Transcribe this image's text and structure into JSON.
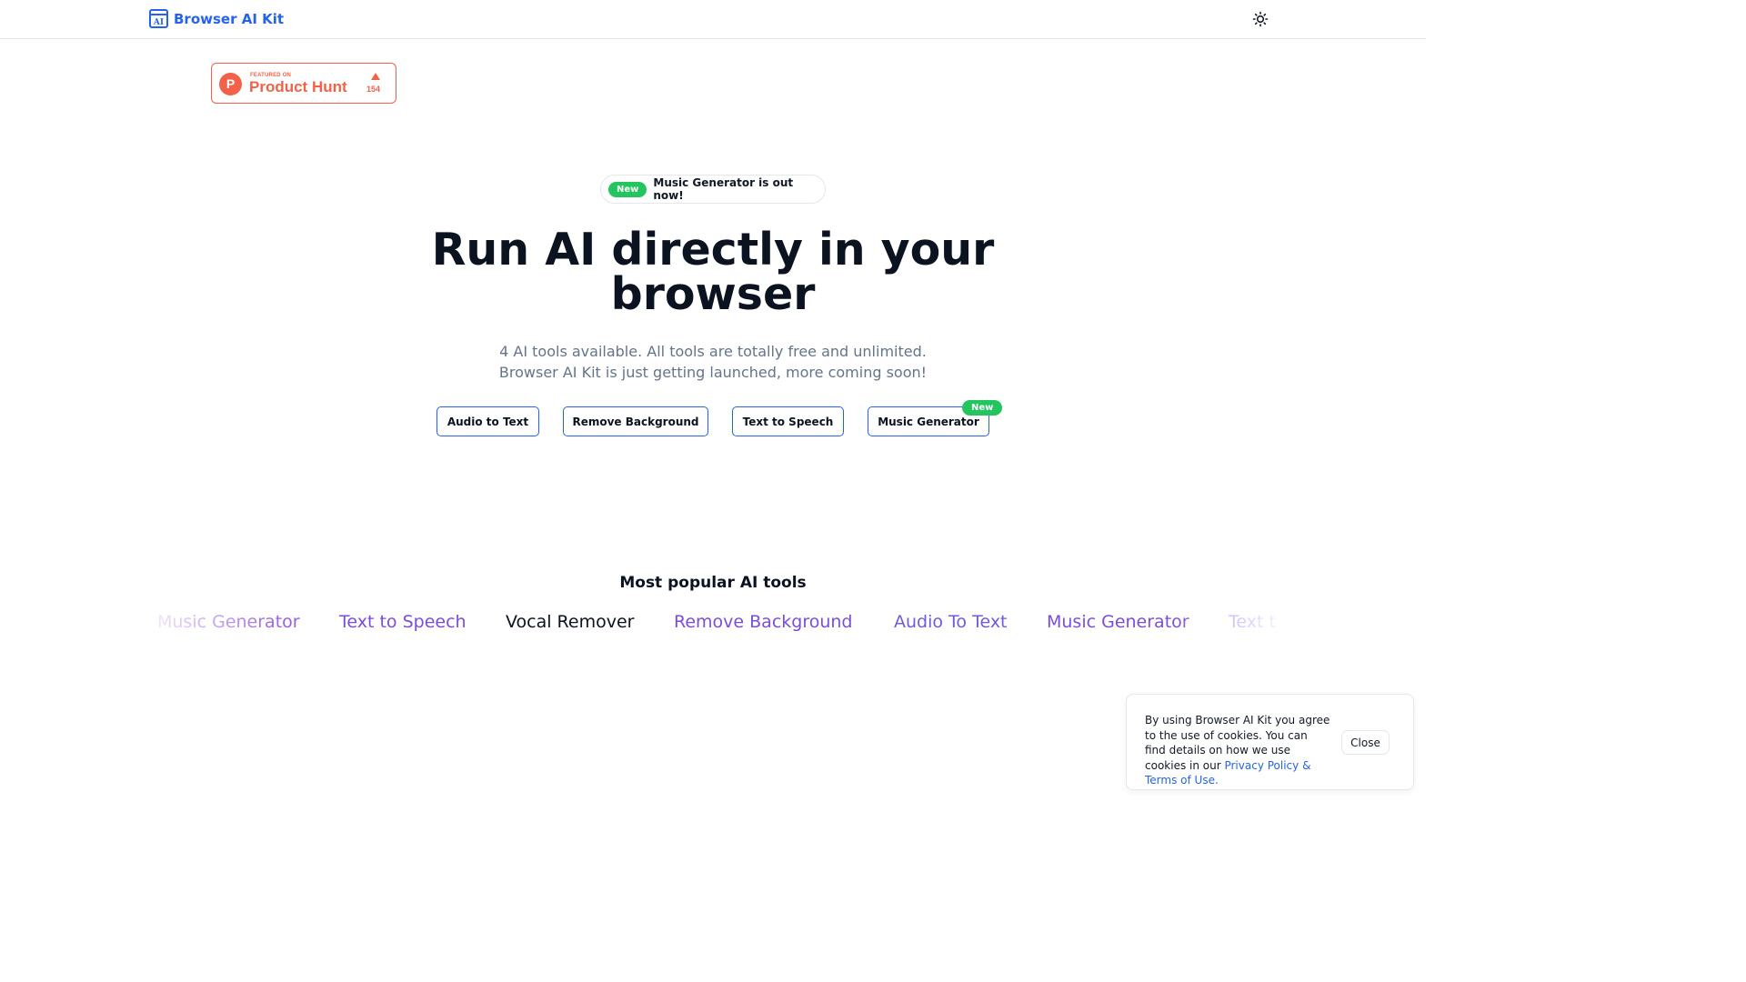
{
  "header": {
    "brand_logo_text": "AI",
    "brand_name": "Browser AI Kit",
    "theme_toggle_icon": "sun-icon"
  },
  "product_hunt": {
    "logo_letter": "P",
    "featured_label": "FEATURED ON",
    "title": "Product Hunt",
    "upvotes": "154"
  },
  "announcement": {
    "badge": "New",
    "text": "Music Generator is out now!"
  },
  "hero": {
    "title": "Run AI directly in your browser",
    "subtitle_line1": "4 AI tools available. All tools are totally free and unlimited.",
    "subtitle_line2": "Browser AI Kit is just getting launched, more coming soon!"
  },
  "tools": [
    {
      "label": "Audio to Text"
    },
    {
      "label": "Remove Background"
    },
    {
      "label": "Text to Speech"
    },
    {
      "label": "Music Generator",
      "badge": "New"
    }
  ],
  "popular": {
    "heading": "Most popular AI tools",
    "items": [
      {
        "label": "Music Generator",
        "color": "#9b5de5"
      },
      {
        "label": "Text to Speech",
        "color": "#7c4ddb"
      },
      {
        "label": "Vocal Remover",
        "color": "#0b1220"
      },
      {
        "label": "Remove Background",
        "color": "#7c4ddb"
      },
      {
        "label": "Audio To Text",
        "color": "#6d5ce0"
      },
      {
        "label": "Music Generator",
        "color": "#7c4ddb"
      },
      {
        "label": "Text t",
        "color": "#a78bfa"
      }
    ]
  },
  "cookie": {
    "text": "By using Browser AI Kit you agree to the use of cookies. You can find details on how we use cookies in our ",
    "link": "Privacy Policy & Terms of Use.",
    "close": "Close"
  },
  "colors": {
    "accent": "#2563eb",
    "new_badge": "#22c55e",
    "product_hunt": "#f26148"
  }
}
